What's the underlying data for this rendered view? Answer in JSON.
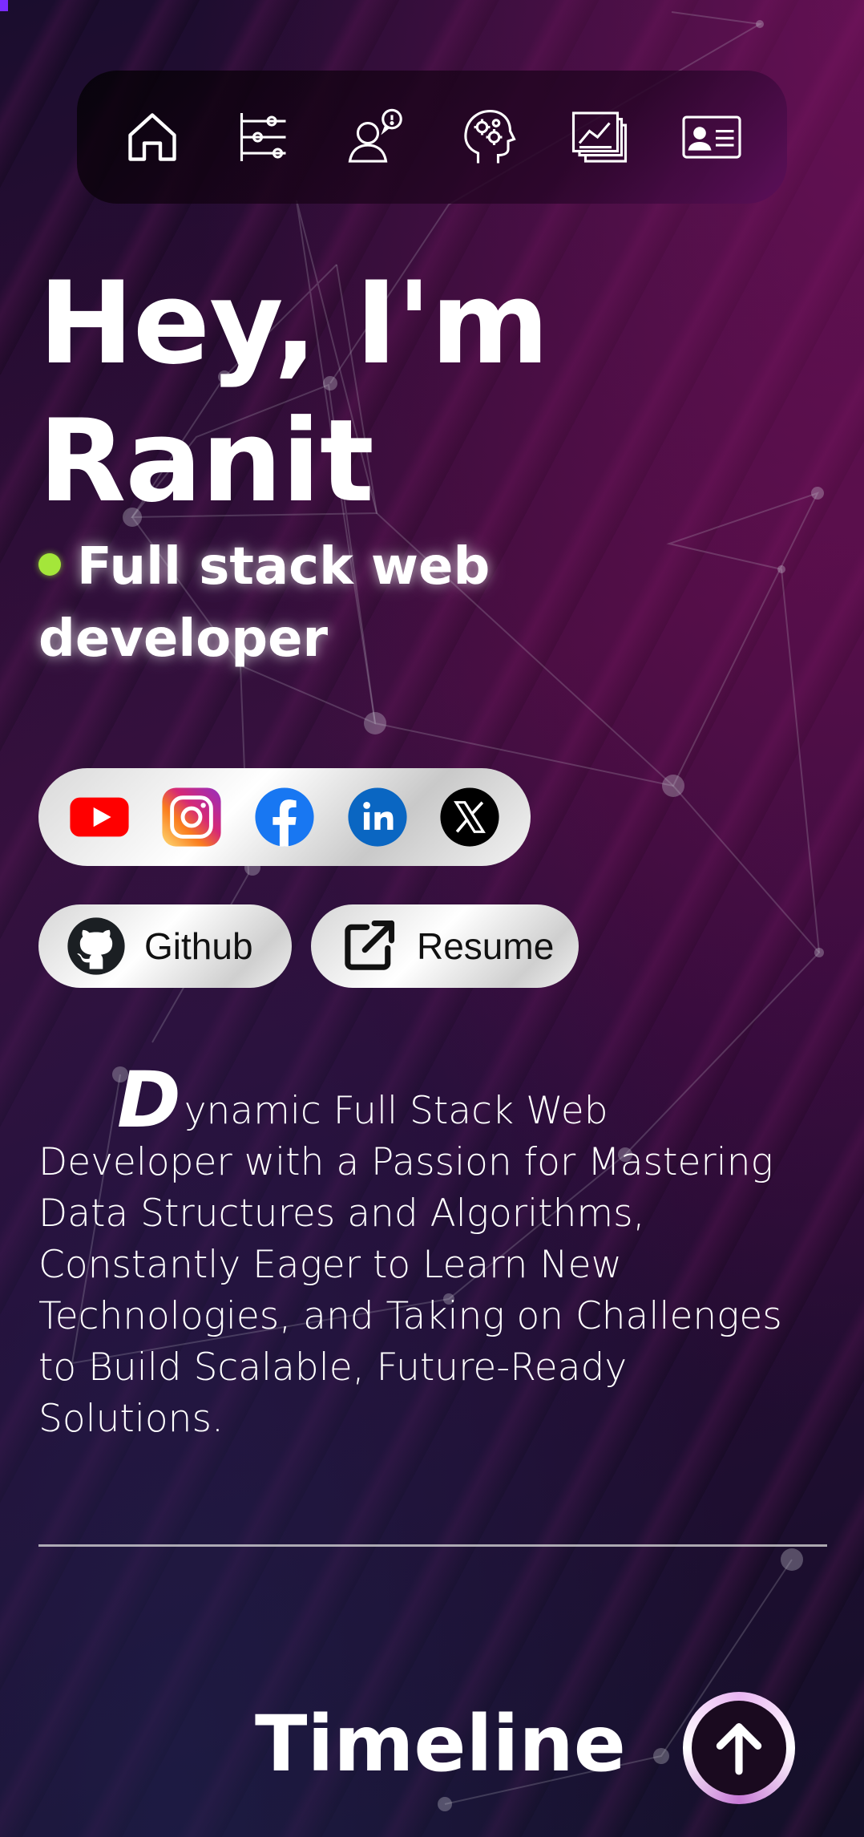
{
  "nav": {
    "items": [
      {
        "icon": "home-icon"
      },
      {
        "icon": "timeline-sliders-icon"
      },
      {
        "icon": "person-chat-icon"
      },
      {
        "icon": "brain-gears-icon"
      },
      {
        "icon": "projects-chart-icon"
      },
      {
        "icon": "contact-card-icon"
      }
    ]
  },
  "hero": {
    "greeting_line1": "Hey, I'm",
    "greeting_line2": "Ranit",
    "role": "Full stack web developer",
    "status_dot_color": "#a4e63a"
  },
  "social": [
    {
      "icon": "youtube-icon",
      "color": "#ff0000"
    },
    {
      "icon": "instagram-icon",
      "color": "#e1306c"
    },
    {
      "icon": "facebook-icon",
      "color": "#1877f2"
    },
    {
      "icon": "linkedin-icon",
      "color": "#0a66c2"
    },
    {
      "icon": "x-twitter-icon",
      "color": "#000000"
    }
  ],
  "buttons": {
    "github_label": "Github",
    "resume_label": "Resume"
  },
  "about": {
    "drop_letter": "D",
    "text": "ynamic Full Stack Web Developer with a Passion for Mastering Data Structures and Algorithms, Constantly Eager to Learn New Technologies, and Taking on Challenges to Build Scalable, Future-Ready Solutions."
  },
  "timeline": {
    "title": "Timeline"
  },
  "colors": {
    "accent": "#a4e63a",
    "background": "#2a0b36"
  }
}
